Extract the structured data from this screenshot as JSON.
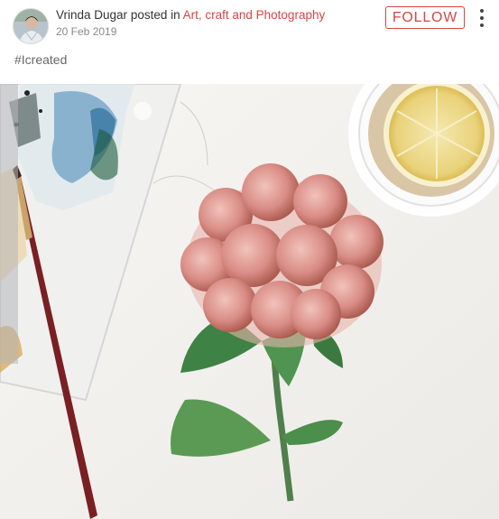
{
  "post": {
    "author": "Vrinda Dugar",
    "posted_in_text": "posted in",
    "category": "Art, craft and Photography",
    "date": "20 Feb 2019",
    "follow_label": "FOLLOW",
    "menu_icon": "kebab-menu-icon",
    "caption": "#Icreated"
  },
  "colors": {
    "accent": "#d64545",
    "text": "#333333",
    "muted": "#8a8a8a"
  }
}
